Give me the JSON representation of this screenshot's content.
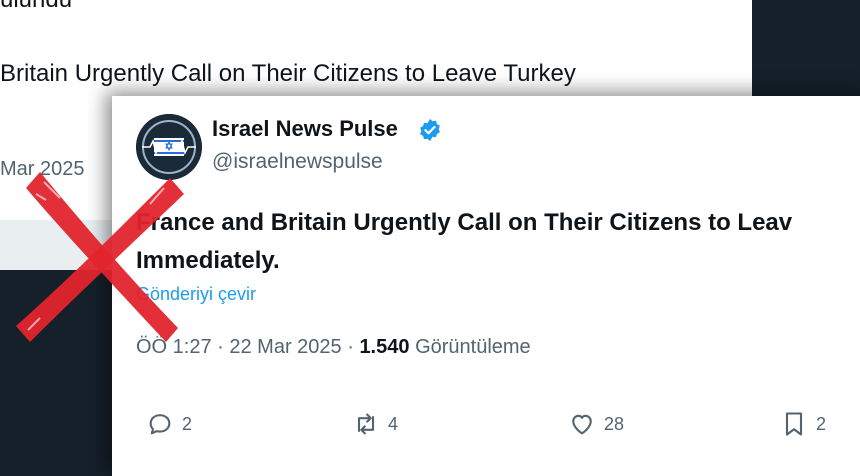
{
  "background_tweet": {
    "top_text": "ulundu",
    "headline": "Britain Urgently Call on Their Citizens to Leave Turkey",
    "date": "Mar 2025"
  },
  "tweet": {
    "author_name": "Israel News Pulse",
    "handle": "@israelnewspulse",
    "text_line1": "France and Britain Urgently Call on Their Citizens to Leav",
    "text_line2": "Immediately.",
    "translate": "Gönderiyi çevir",
    "time": "ÖÖ 1:27 · 22 Mar 2025 · ",
    "views_count": "1.540",
    "views_label": "Görüntüleme"
  },
  "actions": {
    "replies": "2",
    "reposts": "4",
    "likes": "28",
    "bookmarks": "2"
  },
  "colors": {
    "accent": "#1d9bf0",
    "cross": "#e2242c",
    "dark_bg": "#15202b"
  }
}
